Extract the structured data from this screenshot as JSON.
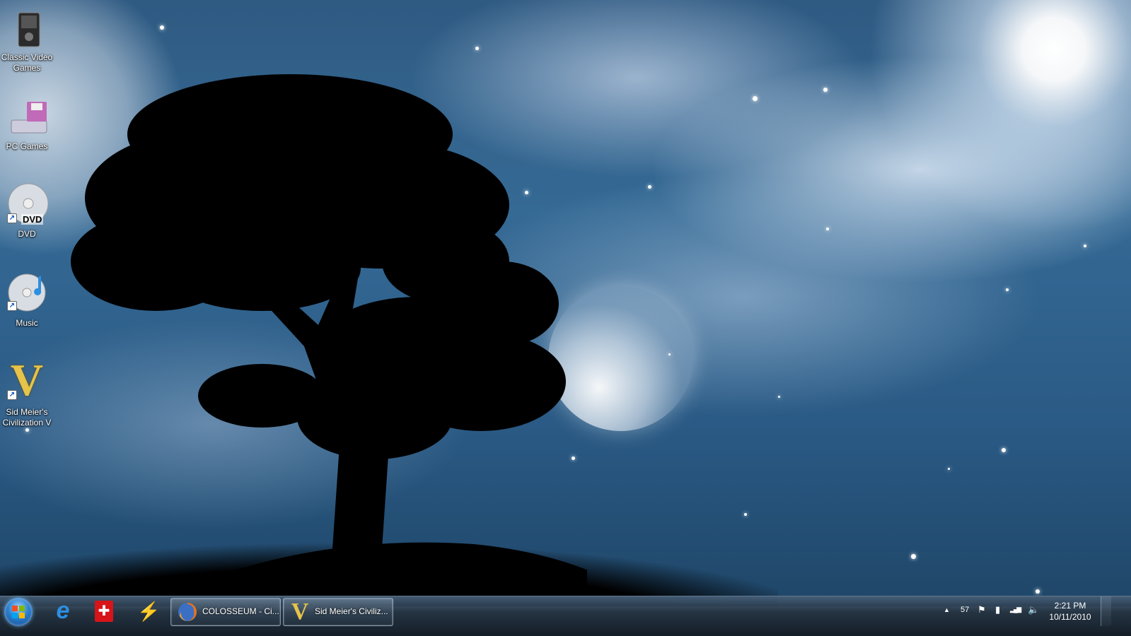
{
  "desktop": {
    "icons": [
      {
        "id": "classic-video-games",
        "label": "Classic Video Games",
        "icon": "game-device-icon"
      },
      {
        "id": "pc-games",
        "label": "PC Games",
        "icon": "floppy-drive-icon"
      },
      {
        "id": "dvd",
        "label": "DVD",
        "icon": "dvd-disc-icon",
        "overlay": "DVD"
      },
      {
        "id": "music",
        "label": "Music",
        "icon": "music-disc-icon"
      },
      {
        "id": "civ5",
        "label": "Sid Meier's Civilization V",
        "icon": "civ-v-icon",
        "glyph": "V"
      }
    ]
  },
  "taskbar": {
    "start": {
      "icon": "windows-start-icon"
    },
    "pinned": [
      {
        "id": "ie",
        "icon": "internet-explorer-icon",
        "glyph": "e"
      },
      {
        "id": "swiss",
        "icon": "swiss-flag-icon",
        "glyph": "✚"
      },
      {
        "id": "bolt",
        "icon": "lightning-app-icon",
        "glyph": "⚡"
      }
    ],
    "tasks": [
      {
        "id": "firefox",
        "label": "COLOSSEUM - Ci...",
        "icon": "firefox-icon"
      },
      {
        "id": "civ",
        "label": "Sid Meier's Civiliz...",
        "icon": "civ-v-icon",
        "glyph": "V"
      }
    ],
    "tray": {
      "expand_glyph": "▲",
      "number": "57",
      "flag_glyph": "⚑",
      "power_glyph": "▮",
      "signal_glyph": "▂▄▆",
      "volume_glyph": "🔈"
    },
    "clock": {
      "time": "2:21 PM",
      "date": "10/11/2010"
    }
  },
  "colors": {
    "civ_gold": "#e6c34a",
    "swiss_red": "#d7141a",
    "ie_blue": "#2d8ee0"
  }
}
